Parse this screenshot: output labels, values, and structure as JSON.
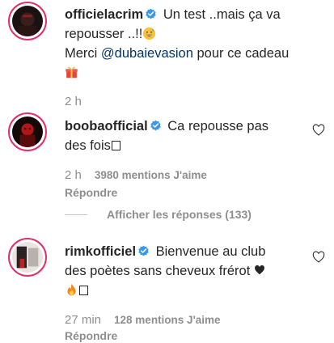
{
  "post": {
    "username": "officielacrim",
    "caption_line1": "Un test ..mais ça va",
    "caption_line2": "repousser ..!!",
    "thanks_text": "Merci ",
    "mention": "@dubaievasion",
    "thanks_suffix": " pour ce cadeau",
    "time": "2 h",
    "emojis": [
      "grinning-sweat-emoji",
      "gift-emoji"
    ]
  },
  "comments": [
    {
      "username": "boobaofficial",
      "text_line1": "Ca repousse pas",
      "text_line2": "des fois",
      "time": "2 h",
      "likes": "3980 mentions J'aime",
      "reply_label": "Répondre"
    },
    {
      "username": "rimkofficiel",
      "text_line1": "Bienvenue au club",
      "text_line2": "des poètes sans cheveux frérot",
      "time": "27 min",
      "likes": "128 mentions J'aime",
      "reply_label": "Répondre"
    }
  ],
  "view_replies_label": "Afficher les réponses (133)",
  "colors": {
    "text": "#262626",
    "muted": "#8e8e8e",
    "mention": "#003569",
    "verified": "#3897f0",
    "story_ring": "#e1306c"
  }
}
